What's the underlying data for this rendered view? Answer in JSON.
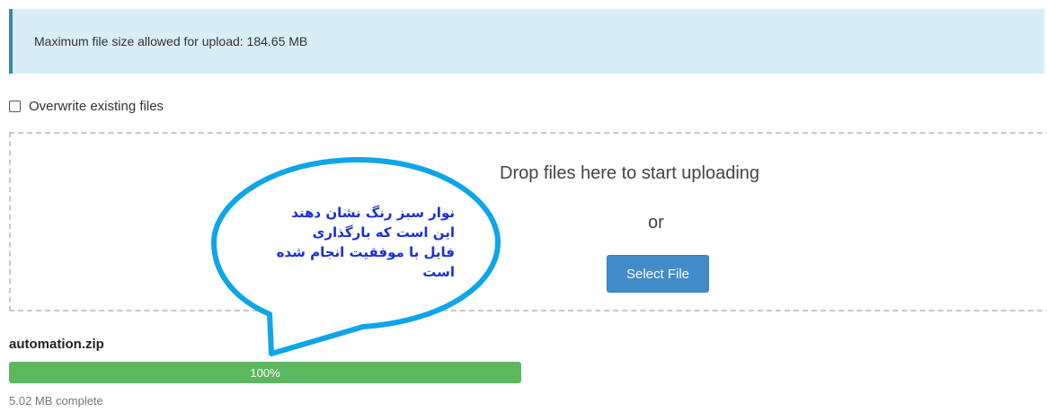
{
  "alert": {
    "text": "Maximum file size allowed for upload: 184.65 MB"
  },
  "options": {
    "overwrite_label": "Overwrite existing files",
    "overwrite_checked": false
  },
  "dropzone": {
    "title": "Drop files here to start uploading",
    "or_text": "or",
    "select_label": "Select File"
  },
  "callout": {
    "text": "نوار سبز رنگ نشان دهند\nاین است که بارگذاری\nفایل با موفقیت انجام شده\nاست",
    "color": "#1a2fd6",
    "border_color": "#0ea5e9"
  },
  "upload": {
    "filename": "automation.zip",
    "progress_label": "100%",
    "progress_fraction": 1.0,
    "status": "5.02 MB complete",
    "bar_color": "#5cb85c"
  }
}
